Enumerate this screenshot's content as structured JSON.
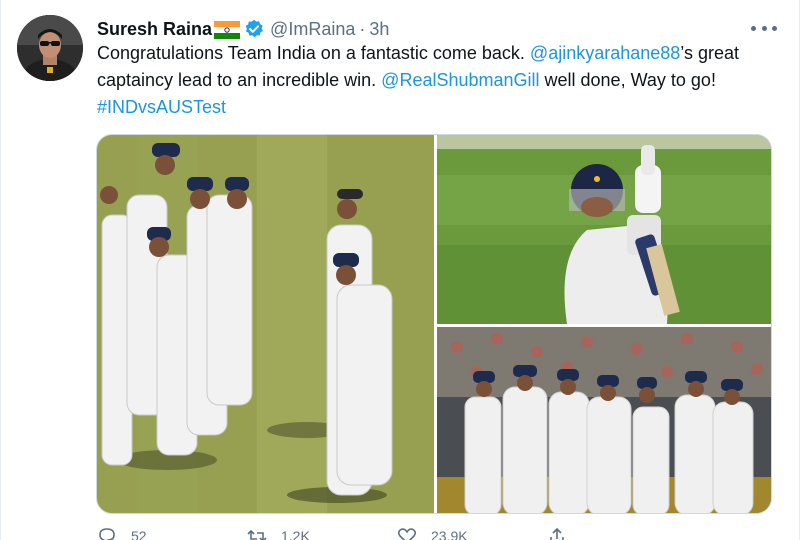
{
  "tweet": {
    "author_name": "Suresh Raina",
    "handle": "@ImRaina",
    "separator": "·",
    "time": "3h",
    "text_1": "Congratulations Team India on a fantastic come back. ",
    "mention_1": "@ajinkyarahane88",
    "text_2": "’s great captaincy lead to an incredible win. ",
    "mention_2": "@RealShubmanGill",
    "text_3": " well done, Way to go! ",
    "hashtag": "#INDvsAUSTest"
  },
  "icons": {
    "flag": "india-flag-icon",
    "verified": "verified-badge-icon",
    "more": "more-options-icon",
    "reply": "reply-icon",
    "retweet": "retweet-icon",
    "like": "like-icon",
    "share": "share-icon"
  },
  "actions": {
    "reply_count": "52",
    "retweet_count": "1.2K",
    "like_count": "23.9K"
  },
  "colors": {
    "link": "#1b95e0",
    "text": "#0f1419",
    "secondary": "#5b7083",
    "verified": "#1da1f2"
  }
}
